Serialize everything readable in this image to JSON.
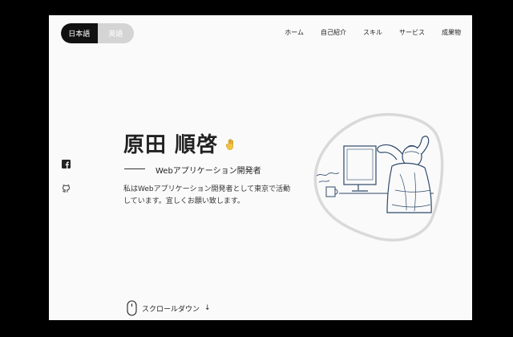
{
  "lang": {
    "ja": "日本語",
    "en": "英語"
  },
  "nav": [
    {
      "label": "ホーム"
    },
    {
      "label": "自己紹介"
    },
    {
      "label": "スキル"
    },
    {
      "label": "サービス"
    },
    {
      "label": "成果物"
    }
  ],
  "social": [
    "facebook-icon",
    "github-icon"
  ],
  "hero": {
    "name": "原田 順啓",
    "wave": "🖐",
    "role": "Webアプリケーション開発者",
    "description": "私はWebアプリケーション開発者として東京で活動しています。宜しくお願い致します。"
  },
  "scroll": {
    "label": "スクロールダウン",
    "arrow": "↓"
  },
  "colors": {
    "dark": "#111111",
    "inactive": "#d4d4d4",
    "illustration": "#2e4a6b",
    "blob": "#d9d9d9",
    "wave": "#f5c542"
  }
}
